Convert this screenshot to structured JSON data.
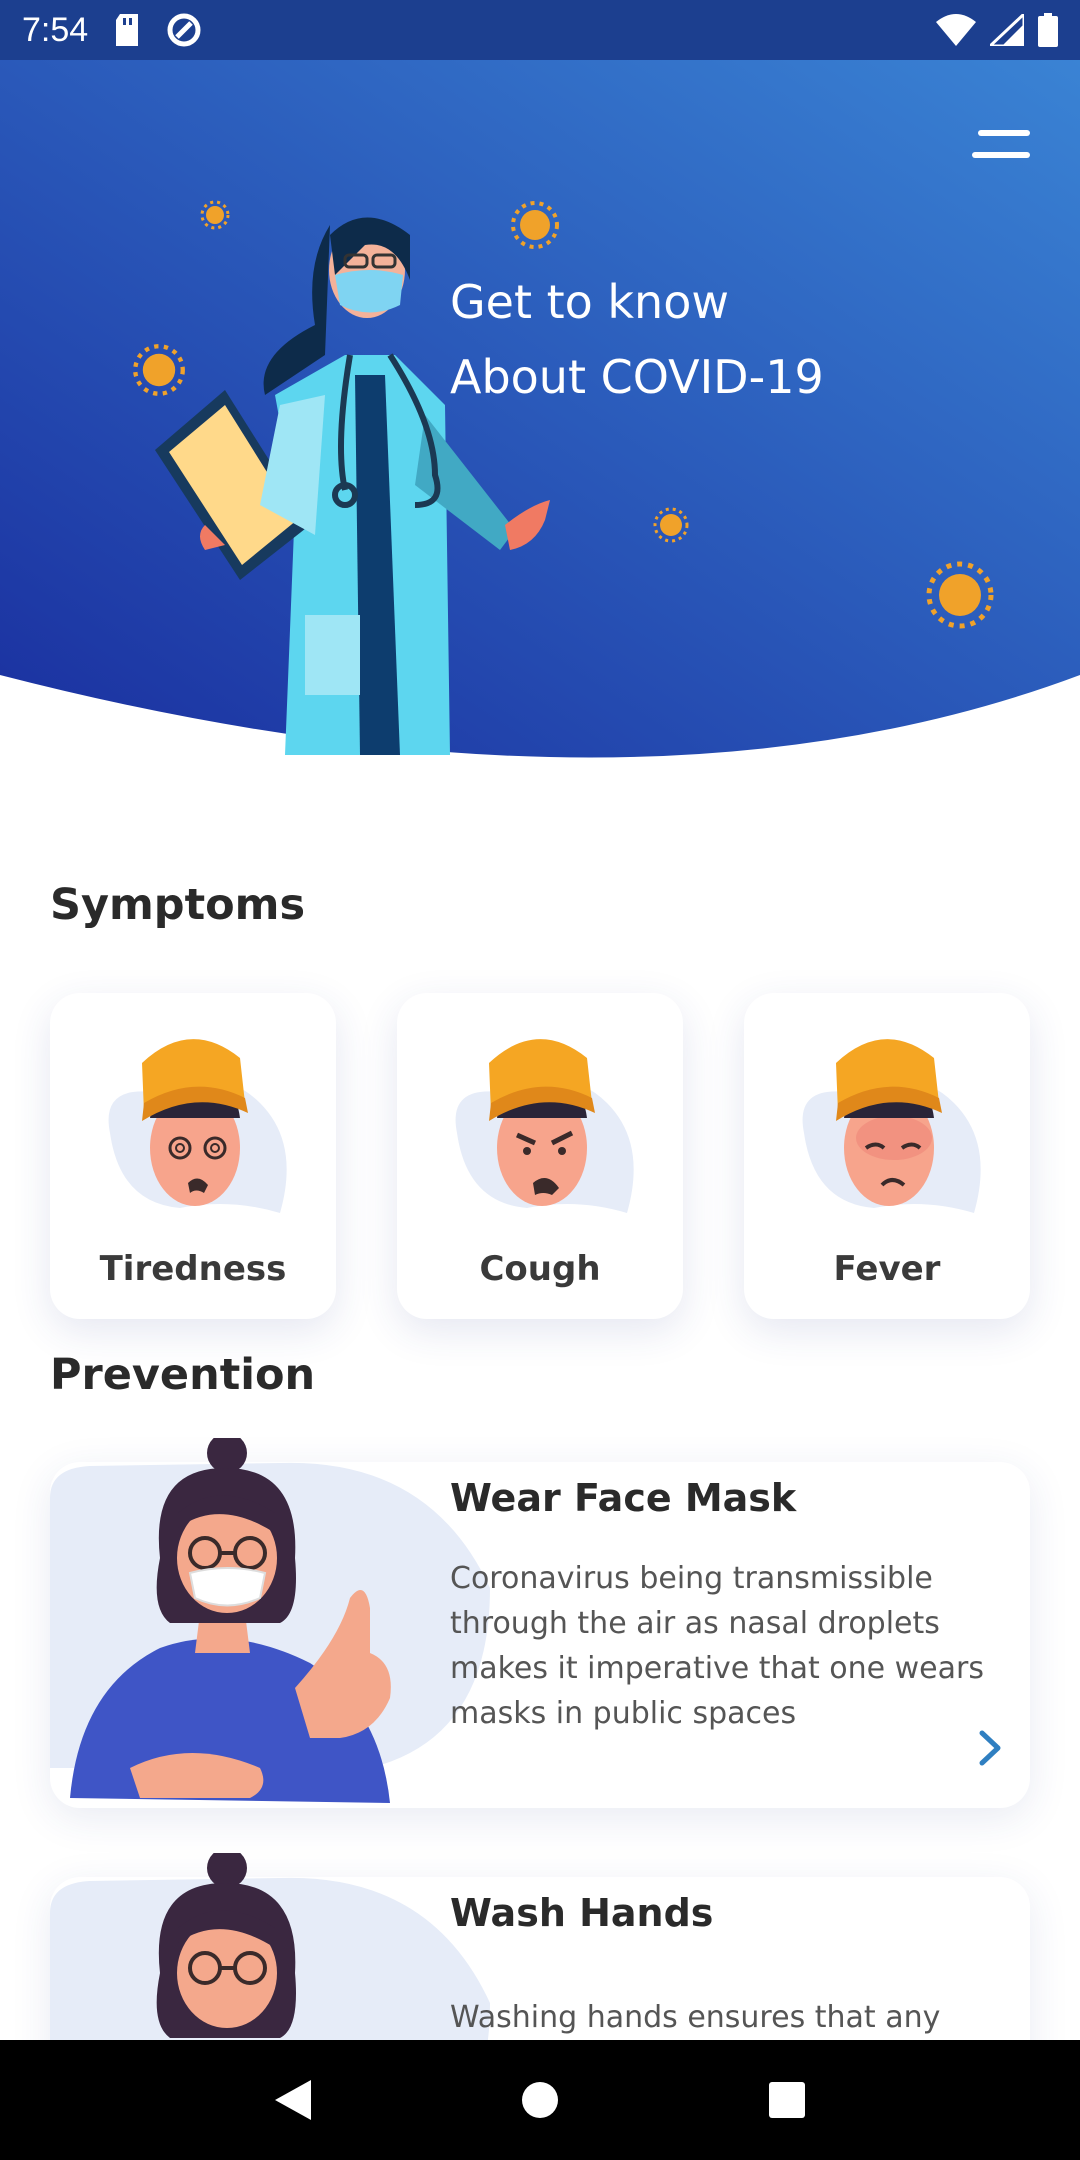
{
  "status_bar": {
    "time": "7:54",
    "icons": [
      "sd-card-icon",
      "data-saver-icon",
      "wifi-icon",
      "signal-icon",
      "battery-icon"
    ]
  },
  "header": {
    "title_line1": "Get to know",
    "title_line2": "About COVID-19",
    "menu_icon": "menu-icon",
    "gradient_start": "#1a2f9f",
    "gradient_end": "#3a83d4"
  },
  "symptoms": {
    "title": "Symptoms",
    "items": [
      {
        "label": "Tiredness"
      },
      {
        "label": "Cough"
      },
      {
        "label": "Fever"
      }
    ]
  },
  "prevention": {
    "title": "Prevention",
    "items": [
      {
        "title": "Wear Face Mask",
        "description": "Coronavirus being transmissible through the air as nasal droplets makes it imperative that one wears masks in public spaces"
      },
      {
        "title": "Wash Hands",
        "description": "Washing hands ensures that any"
      }
    ]
  },
  "nav_bar": {
    "icons": [
      "back-icon",
      "home-icon",
      "recents-icon"
    ]
  },
  "colors": {
    "accent": "#2f7fc1",
    "virus": "#f0a22a",
    "text_dark": "#2a2a2a"
  }
}
